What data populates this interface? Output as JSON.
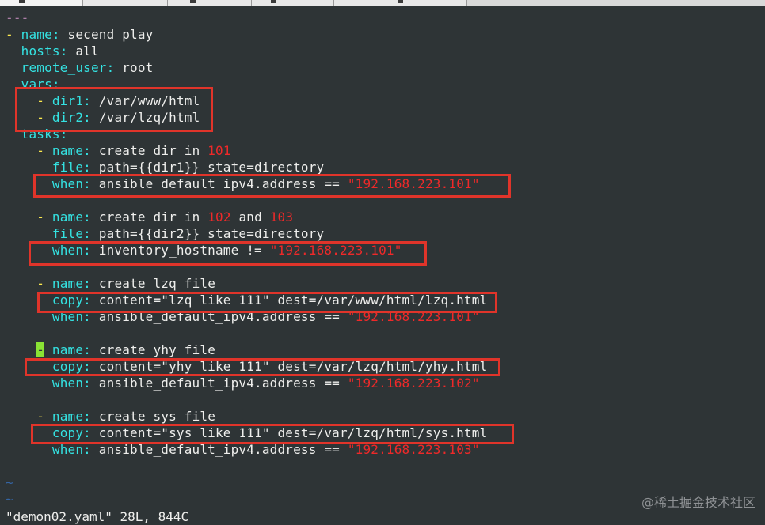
{
  "editor": {
    "doc_start": "---",
    "play": {
      "name_key": "name",
      "name_value": "secend play",
      "hosts_key": "hosts",
      "hosts_value": "all",
      "remote_user_key": "remote_user",
      "remote_user_value": "root",
      "vars_key": "vars",
      "vars": [
        {
          "key": "dir1",
          "value": "/var/www/html"
        },
        {
          "key": "dir2",
          "value": "/var/lzq/html"
        }
      ],
      "tasks_key": "tasks"
    },
    "tasks": [
      {
        "name_key": "name",
        "name_text": "create dir in ",
        "name_num": "101",
        "name_rest": "",
        "action_key": "file",
        "action_value": "path={{dir1}} state=directory",
        "when_key": "when",
        "when_expr": "ansible_default_ipv4.address == ",
        "when_str": "\"192.168.223.101\""
      },
      {
        "name_key": "name",
        "name_text": "create dir in ",
        "name_num": "102",
        "name_mid": " and ",
        "name_num2": "103",
        "action_key": "file",
        "action_value": "path={{dir2}} state=directory",
        "when_key": "when",
        "when_expr": "inventory_hostname != ",
        "when_str": "\"192.168.223.101\""
      },
      {
        "name_key": "name",
        "name_text": "create lzq file",
        "action_key": "copy",
        "action_value": "content=\"lzq like 111\" dest=/var/www/html/lzq.html",
        "when_key": "when",
        "when_expr": "ansible_default_ipv4.address == ",
        "when_str": "\"192.168.223.101\""
      },
      {
        "name_key": "name",
        "name_text": "create yhy file",
        "action_key": "copy",
        "action_value": "content=\"yhy like 111\" dest=/var/lzq/html/yhy.html",
        "when_key": "when",
        "when_expr": "ansible_default_ipv4.address == ",
        "when_str": "\"192.168.223.102\""
      },
      {
        "name_key": "name",
        "name_text": "create sys file",
        "action_key": "copy",
        "action_value": "content=\"sys like 111\" dest=/var/lzq/html/sys.html",
        "when_key": "when",
        "when_expr": "ansible_default_ipv4.address == ",
        "when_str": "\"192.168.223.103\""
      }
    ],
    "empty_marker": "~"
  },
  "statusline": "\"demon02.yaml\" 28L, 844C",
  "watermark": "@稀土掘金技术社区",
  "colors": {
    "background": "#2e3436",
    "key": "#34e2e2",
    "string": "#ef2929",
    "list_dash": "#fce94f",
    "highlight_box": "#e0342a",
    "cursor": "#8ae234"
  }
}
